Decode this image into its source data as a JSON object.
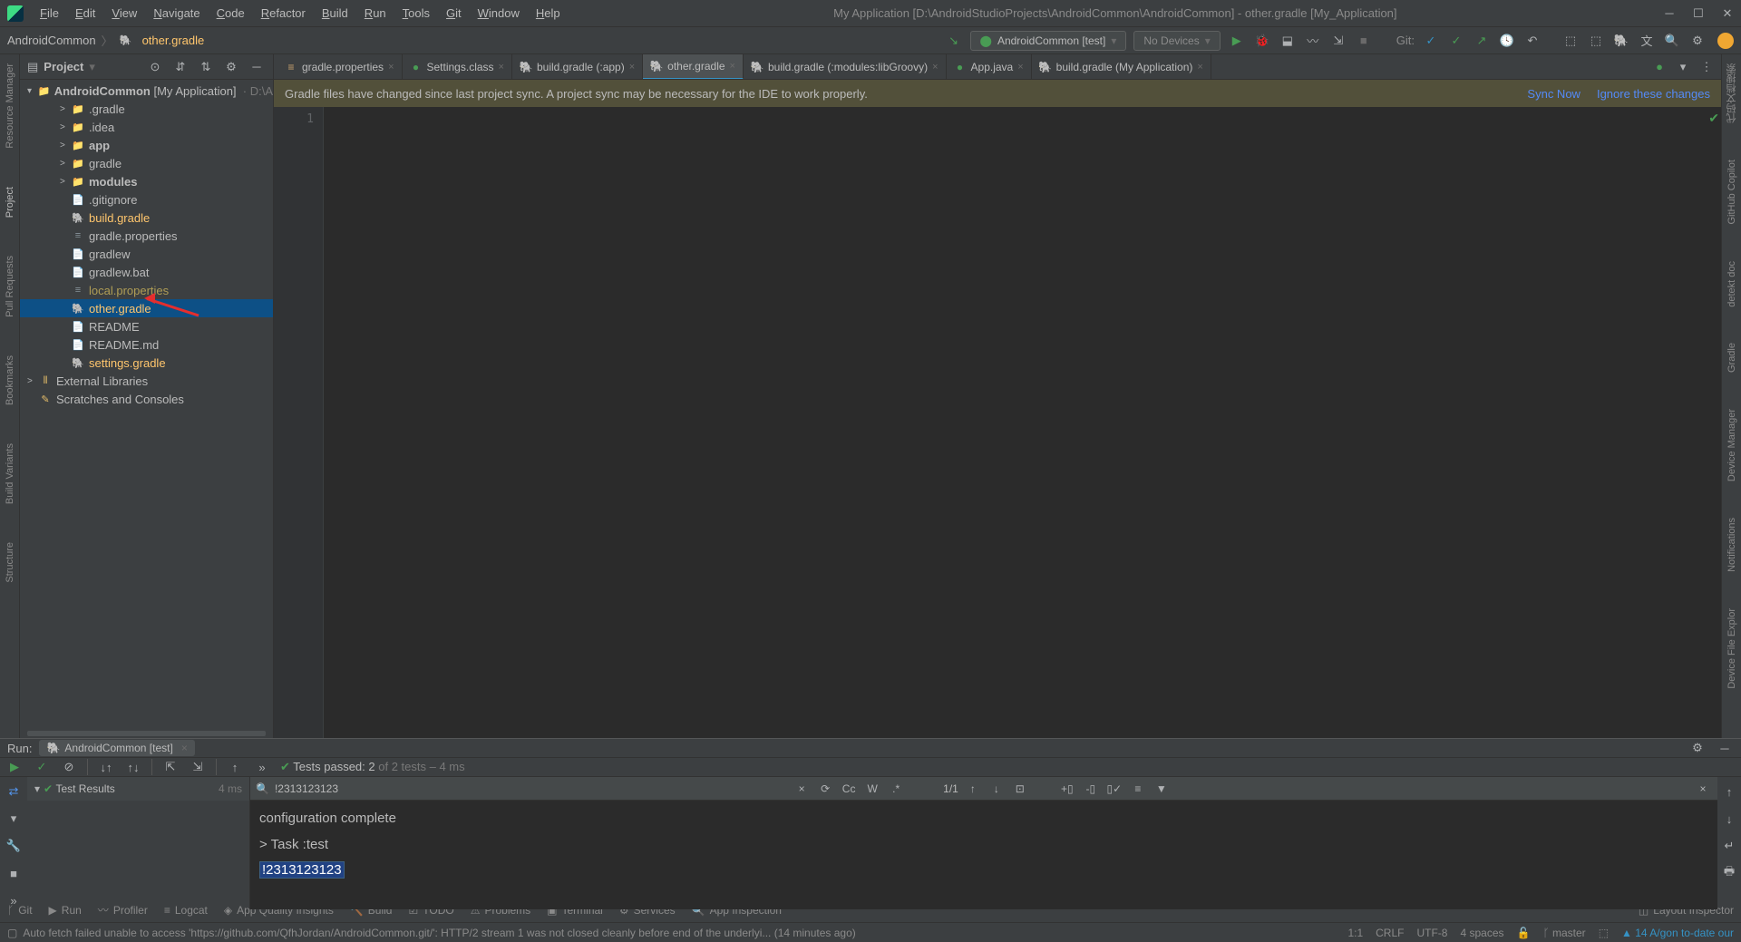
{
  "menu": [
    "File",
    "Edit",
    "View",
    "Navigate",
    "Code",
    "Refactor",
    "Build",
    "Run",
    "Tools",
    "Git",
    "Window",
    "Help"
  ],
  "title": "My Application [D:\\AndroidStudioProjects\\AndroidCommon\\AndroidCommon] - other.gradle [My_Application]",
  "breadcrumb": {
    "project": "AndroidCommon",
    "file": "other.gradle"
  },
  "toolbar": {
    "config": "AndroidCommon [test]",
    "device": "No Devices",
    "git_label": "Git:"
  },
  "panel": {
    "title": "Project"
  },
  "tree": {
    "root": "AndroidCommon",
    "root_hint": "[My Application]",
    "root_path": "· D:\\A",
    "items": [
      {
        "label": ".gradle",
        "type": "folder-orange",
        "arrow": ">",
        "indent": 1
      },
      {
        "label": ".idea",
        "type": "folder",
        "arrow": ">",
        "indent": 1
      },
      {
        "label": "app",
        "type": "folder",
        "arrow": ">",
        "indent": 1,
        "bold": true
      },
      {
        "label": "gradle",
        "type": "folder",
        "arrow": ">",
        "indent": 1
      },
      {
        "label": "modules",
        "type": "folder",
        "arrow": ">",
        "indent": 1,
        "bold": true
      },
      {
        "label": ".gitignore",
        "type": "file",
        "indent": 1
      },
      {
        "label": "build.gradle",
        "type": "gradle",
        "indent": 1,
        "highlight": true
      },
      {
        "label": "gradle.properties",
        "type": "prop",
        "indent": 1
      },
      {
        "label": "gradlew",
        "type": "file",
        "indent": 1
      },
      {
        "label": "gradlew.bat",
        "type": "file",
        "indent": 1
      },
      {
        "label": "local.properties",
        "type": "prop",
        "indent": 1,
        "yellow": true
      },
      {
        "label": "other.gradle",
        "type": "gradle",
        "indent": 1,
        "selected": true,
        "highlight": true
      },
      {
        "label": "README",
        "type": "file",
        "indent": 1
      },
      {
        "label": "README.md",
        "type": "file",
        "indent": 1
      },
      {
        "label": "settings.gradle",
        "type": "gradle",
        "indent": 1,
        "highlight": true
      }
    ],
    "ext_lib": "External Libraries",
    "scratches": "Scratches and Consoles"
  },
  "tabs": [
    {
      "label": "gradle.properties",
      "icon": "prop"
    },
    {
      "label": "Settings.class",
      "icon": "class"
    },
    {
      "label": "build.gradle (:app)",
      "icon": "gradle"
    },
    {
      "label": "other.gradle",
      "icon": "gradle",
      "active": true
    },
    {
      "label": "build.gradle (:modules:libGroovy)",
      "icon": "gradle"
    },
    {
      "label": "App.java",
      "icon": "class"
    },
    {
      "label": "build.gradle (My Application)",
      "icon": "gradle"
    }
  ],
  "notification": {
    "text": "Gradle files have changed since last project sync. A project sync may be necessary for the IDE to work properly.",
    "sync": "Sync Now",
    "ignore": "Ignore these changes"
  },
  "editor": {
    "line": "1"
  },
  "run": {
    "label": "Run:",
    "config": "AndroidCommon [test]",
    "tests": {
      "prefix": "Tests passed:",
      "count": "2",
      "suffix": "of 2 tests – 4 ms"
    },
    "results": "Test Results",
    "time": "4 ms",
    "search": "!2313123123",
    "search_pos": "1/1",
    "out1": "configuration complete",
    "out2": "> Task :test",
    "out3": "!2313123123"
  },
  "left_gutter": [
    "Resource Manager",
    "Project",
    "Pull Requests",
    "Bookmarks",
    "Build Variants",
    "Structure"
  ],
  "right_gutter": [
    "代码文档搜索",
    "GitHub Copilot",
    "detekt doc",
    "Gradle",
    "Device Manager",
    "Notifications",
    "Device File Explor"
  ],
  "bottom_tabs": [
    {
      "icon": "git",
      "label": "Git"
    },
    {
      "icon": "run",
      "label": "Run"
    },
    {
      "icon": "profiler",
      "label": "Profiler"
    },
    {
      "icon": "logcat",
      "label": "Logcat"
    },
    {
      "icon": "quality",
      "label": "App Quality Insights"
    },
    {
      "icon": "build",
      "label": "Build"
    },
    {
      "icon": "todo",
      "label": "TODO"
    },
    {
      "icon": "problems",
      "label": "Problems"
    },
    {
      "icon": "terminal",
      "label": "Terminal"
    },
    {
      "icon": "services",
      "label": "Services"
    },
    {
      "icon": "inspect",
      "label": "App Inspection"
    }
  ],
  "layout_inspector": "Layout Inspector",
  "status": {
    "msg": "Auto fetch failed unable to access 'https://github.com/QfhJordan/AndroidCommon.git/': HTTP/2 stream 1 was not closed cleanly before end of the underlyi... (14 minutes ago)",
    "pos": "1:1",
    "eol": "CRLF",
    "enc": "UTF-8",
    "indent": "4 spaces",
    "branch": "master",
    "copilot": "14 A/gon to-date our"
  }
}
